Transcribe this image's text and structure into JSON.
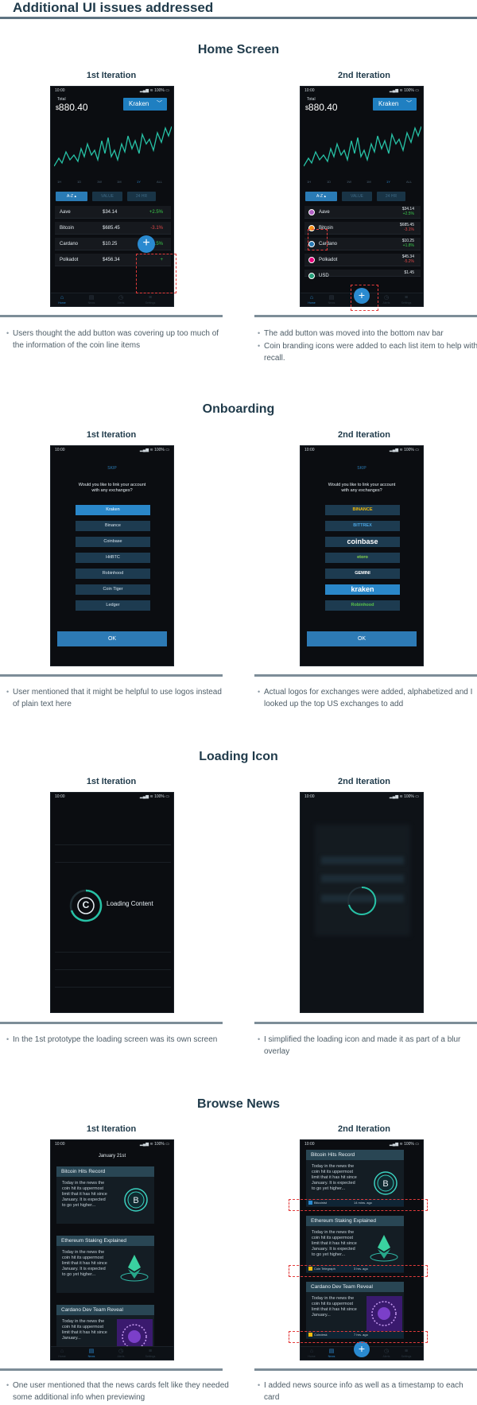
{
  "page": {
    "title": "Additional UI issues addressed"
  },
  "labels": {
    "first_iteration": "1st Iteration",
    "second_iteration": "2nd Iteration"
  },
  "statusbar": {
    "time": "10:00",
    "right": "▂▄▆ ≋ 100% ▭"
  },
  "home": {
    "title": "Home Screen",
    "total_label": "Total",
    "currency": "$",
    "total_value": "880.40",
    "exchange": "Kraken",
    "timeframes": [
      "1H",
      "1D",
      "1W",
      "1M",
      "1Y",
      "ALL"
    ],
    "filters": [
      "A-Z",
      "VALUE",
      "24 HR"
    ],
    "coins_v1": [
      {
        "name": "Aave",
        "price": "$34.14",
        "change": "+2.5%",
        "dir": "pos"
      },
      {
        "name": "Bitcoin",
        "price": "$685.45",
        "change": "-3.1%",
        "dir": "neg"
      },
      {
        "name": "Cardano",
        "price": "$10.25",
        "change": "+2.5%",
        "dir": "pos"
      },
      {
        "name": "Polkadot",
        "price": "$456.34",
        "change": "+",
        "dir": "pos"
      }
    ],
    "coins_v2": [
      {
        "name": "Aave",
        "price": "$34.14",
        "change": "+2.5%",
        "dir": "pos",
        "color": "#b05fc4"
      },
      {
        "name": "Bitcoin",
        "price": "$685.45",
        "change": "-3.1%",
        "dir": "neg",
        "color": "#f7931a"
      },
      {
        "name": "Cardano",
        "price": "$10.25",
        "change": "+1.8%",
        "dir": "pos",
        "color": "#2a7bb5"
      },
      {
        "name": "Polkadot",
        "price": "$45.34",
        "change": "-5.2%",
        "dir": "neg",
        "color": "#e6007a"
      },
      {
        "name": "USD",
        "price": "$1.45",
        "change": "",
        "dir": "pos",
        "color": "#26a17b"
      }
    ],
    "add_label": "+",
    "nav": [
      "Home",
      "News",
      "Alerts",
      "Settings"
    ],
    "notes_v1": [
      "Users thought the add button was covering up too much of the information of the coin line items"
    ],
    "notes_v2": [
      "The add button was moved into the bottom nav bar",
      "Coin branding icons were added to each list item to help with recall."
    ]
  },
  "onboarding": {
    "title": "Onboarding",
    "skip": "SKIP",
    "question_line1": "Would you like to link your account",
    "question_line2": "with any exchanges?",
    "exchanges_v1": [
      "Kraken",
      "Binance",
      "Coinbase",
      "HitBTC",
      "Robinhood",
      "Coin Tiger",
      "Ledger"
    ],
    "exchanges_v2": [
      "BINANCE",
      "BITTREX",
      "coinbase",
      "etoro",
      "GEMINI",
      "kraken",
      "Robinhood"
    ],
    "exchange_colors_v2": [
      "#f0b90b",
      "#4aa3df",
      "#ffffff",
      "#8ad64a",
      "#ffffff",
      "#ffffff",
      "#59c34a"
    ],
    "ok": "OK",
    "notes_v1": [
      "User mentioned that it might be helpful to use logos instead of plain text here"
    ],
    "notes_v2": [
      "Actual logos for exchanges were added, alphabetized and I looked up the top US exchanges to add"
    ]
  },
  "loading": {
    "title": "Loading Icon",
    "logo_letter": "C",
    "text": "Loading Content",
    "notes_v1": [
      "In the 1st prototype the loading screen was its own screen"
    ],
    "notes_v2": [
      "I simplified the loading icon and made it as part of a blur overlay"
    ]
  },
  "news": {
    "title": "Browse News",
    "date": "January 21st",
    "cards": [
      {
        "headline": "Bitcoin Hits Record",
        "body": [
          "Today in the news the",
          "coin hit its uppermost",
          "limit that it has hit since",
          "January. It is expected",
          "to go yet higher..."
        ],
        "source": "Bitcoinist",
        "time": "14 mins. ago",
        "art": "btc"
      },
      {
        "headline": "Ethereum Staking Explained",
        "body": [
          "Today in the news the",
          "coin hit its uppermost",
          "limit that it has hit since",
          "January. It is expected",
          "to go yet higher..."
        ],
        "source": "Coin Telegraph",
        "time": "3 hrs. ago",
        "art": "eth"
      },
      {
        "headline": "Cardano Dev Team Reveal",
        "body": [
          "Today in the news the",
          "coin hit its uppermost",
          "limit that it has hit since",
          "January..."
        ],
        "source": "Coindesk",
        "time": "7 hrs. ago",
        "art": "ada"
      }
    ],
    "notes_v1": [
      "One user mentioned that the news cards felt like they needed some additional info when previewing"
    ],
    "notes_v2": [
      "I added news source info as well as a timestamp to each card"
    ]
  },
  "colors": {
    "accent": "#2a8ad0",
    "positive": "#3ccc4c",
    "negative": "#e04848",
    "annotation": "#e33b3b",
    "chart_line": "#27c2a6"
  }
}
